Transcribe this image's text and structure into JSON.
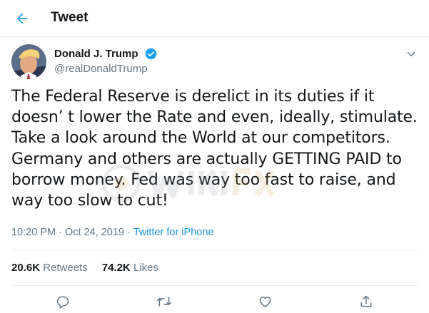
{
  "header": {
    "title": "Tweet",
    "back_icon": "arrow-left-icon"
  },
  "tweet": {
    "author": {
      "display_name": "Donald J. Trump",
      "handle": "@realDonaldTrump",
      "verified": true
    },
    "text": "The Federal Reserve is derelict in its duties if it doesn’ t lower the Rate and even, ideally, stimulate. Take a look around the World at our competitors. Germany and others are  actually GETTING PAID to borrow money. Fed was way too fast to raise, and way too slow to cut!",
    "time": "10:20 PM",
    "separator": " · ",
    "date": "Oct 24, 2019",
    "source": "Twitter for iPhone",
    "retweets": {
      "count": "20.6K",
      "label": "Retweets"
    },
    "likes": {
      "count": "74.2K",
      "label": "Likes"
    }
  },
  "actions": [
    "reply-icon",
    "retweet-icon",
    "like-icon",
    "share-icon"
  ],
  "colors": {
    "accent": "#1da1f2",
    "link": "#1b95e0",
    "text": "#14171a",
    "secondary": "#657786",
    "border": "#e6ecf0"
  }
}
